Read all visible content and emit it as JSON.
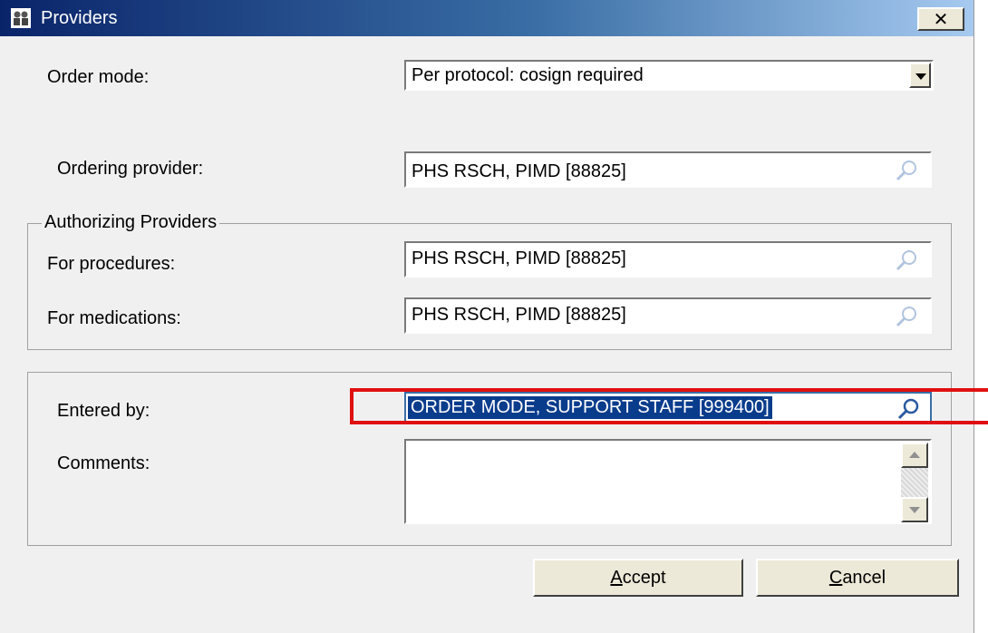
{
  "window": {
    "title": "Providers",
    "close_label": "✕"
  },
  "order_mode": {
    "label": "Order mode:",
    "value": "Per protocol: cosign required"
  },
  "ordering_provider": {
    "label": "Ordering provider:",
    "value": "PHS RSCH, PIMD [88825]"
  },
  "authorizing": {
    "legend": "Authorizing Providers",
    "procedures_label": "For procedures:",
    "procedures_value": "PHS RSCH, PIMD [88825]",
    "medications_label": "For medications:",
    "medications_value": "PHS RSCH, PIMD [88825]"
  },
  "entered_by": {
    "label": "Entered by:",
    "value": "ORDER MODE, SUPPORT STAFF [999400]"
  },
  "comments": {
    "label": "Comments:",
    "value": ""
  },
  "buttons": {
    "accept_mnemonic": "A",
    "accept_rest": "ccept",
    "cancel_mnemonic": "C",
    "cancel_rest": "ancel"
  },
  "colors": {
    "highlight": "#e01010",
    "selection": "#0a3c8c",
    "titlebar_start": "#0a246a"
  }
}
